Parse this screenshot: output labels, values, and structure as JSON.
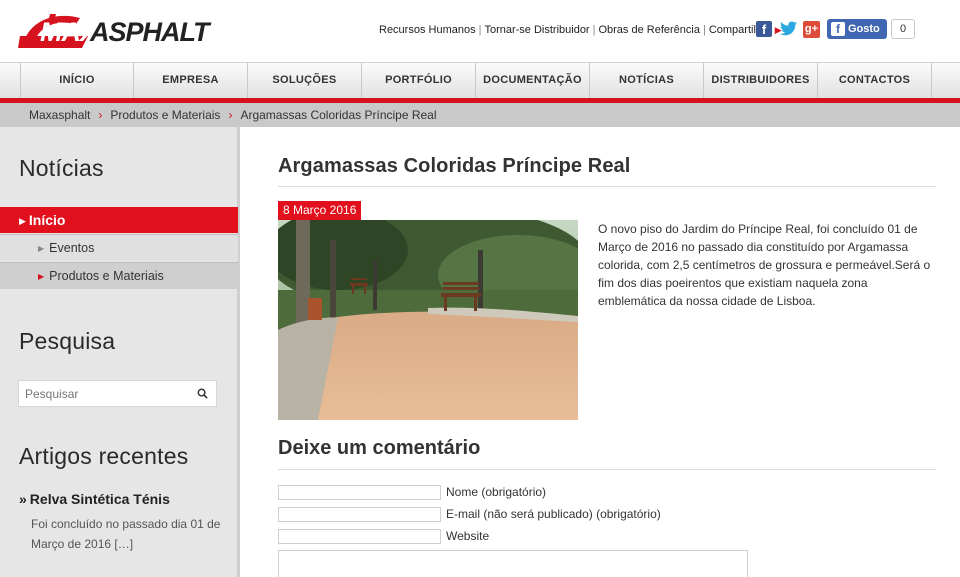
{
  "brand": {
    "max": "MAX",
    "asphalt": "ASPHALT",
    "accent": "#d6121e"
  },
  "toplinks": {
    "items": [
      "Recursos Humanos",
      "Tornar-se Distribuidor",
      "Obras de Referência",
      "Compartilhar"
    ],
    "gosto_label": "Gosto",
    "gosto_count": "0"
  },
  "nav": {
    "items": [
      "INÍCIO",
      "EMPRESA",
      "SOLUÇÕES",
      "PORTFÓLIO",
      "DOCUMENTAÇÃO",
      "NOTÍCIAS",
      "DISTRIBUIDORES",
      "CONTACTOS"
    ]
  },
  "breadcrumb": [
    "Maxasphalt",
    "Produtos e Materiais",
    "Argamassas Coloridas Príncipe Real"
  ],
  "sidebar": {
    "news_title": "Notícias",
    "menu": [
      "Início",
      "Eventos",
      "Produtos e Materiais"
    ],
    "search_title": "Pesquisa",
    "search_placeholder": "Pesquisar",
    "recent_title": "Artigos recentes",
    "recent_post_title": "Relva Sintética Ténis",
    "recent_post_excerpt": "Foi concluído no passado dia 01 de Março de 2016 […]"
  },
  "post": {
    "title": "Argamassas Coloridas Príncipe Real",
    "date": "8 Março 2016",
    "body": "O novo piso do Jardim do Príncipe Real, foi concluído 01 de Março de 2016 no passado dia constituído por Argamassa colorida,  com 2,5 centímetros de grossura e permeável.Será o fim dos dias poeirentos que existiam naquela zona emblemática da nossa cidade de Lisboa."
  },
  "comment": {
    "title": "Deixe um comentário",
    "name_label": "Nome (obrigatório)",
    "email_label": "E-mail (não será publicado) (obrigatório)",
    "website_label": "Website"
  }
}
